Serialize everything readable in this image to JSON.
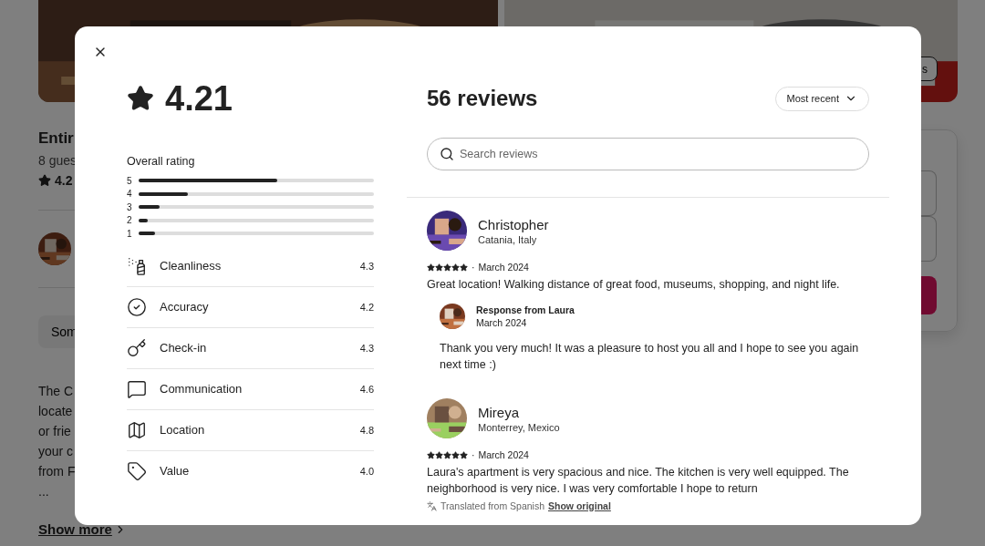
{
  "background": {
    "photo_button": "s",
    "title": "Entir",
    "subtitle": "8 gues",
    "rating": "4.2",
    "pill": "Som",
    "description": [
      "The C",
      "locate",
      "or frie",
      "your c",
      "from F",
      "..."
    ],
    "show_more": "Show more"
  },
  "modal": {
    "rating": "4.21",
    "overall_label": "Overall rating",
    "bars": [
      {
        "label": "5",
        "level": 0.59
      },
      {
        "label": "4",
        "level": 0.21
      },
      {
        "label": "3",
        "level": 0.09
      },
      {
        "label": "2",
        "level": 0.04
      },
      {
        "label": "1",
        "level": 0.07
      }
    ],
    "categories": [
      {
        "label": "Cleanliness",
        "value": "4.3"
      },
      {
        "label": "Accuracy",
        "value": "4.2"
      },
      {
        "label": "Check-in",
        "value": "4.3"
      },
      {
        "label": "Communication",
        "value": "4.6"
      },
      {
        "label": "Location",
        "value": "4.8"
      },
      {
        "label": "Value",
        "value": "4.0"
      }
    ],
    "reviews_title": "56 reviews",
    "sort": "Most recent",
    "search": {
      "placeholder": "Search reviews"
    },
    "reviews": [
      {
        "name": "Christopher",
        "location": "Catania, Italy",
        "stars": 5,
        "separator": "·",
        "date": "March 2024",
        "text": "Great location! Walking distance of great food, museums, shopping, and night life.",
        "response": {
          "title": "Response from Laura",
          "date": "March 2024",
          "text": "Thank you very much! It was a pleasure to host you all and I hope to see you again next time :)"
        }
      },
      {
        "name": "Mireya",
        "location": "Monterrey, Mexico",
        "stars": 5,
        "separator": "·",
        "date": "March 2024",
        "text": "Laura's apartment is very spacious and nice. The kitchen is very well equipped. The neighborhood is very nice. I was very comfortable I hope to return",
        "translation": {
          "note": "Translated from Spanish",
          "link": "Show original"
        }
      }
    ]
  }
}
